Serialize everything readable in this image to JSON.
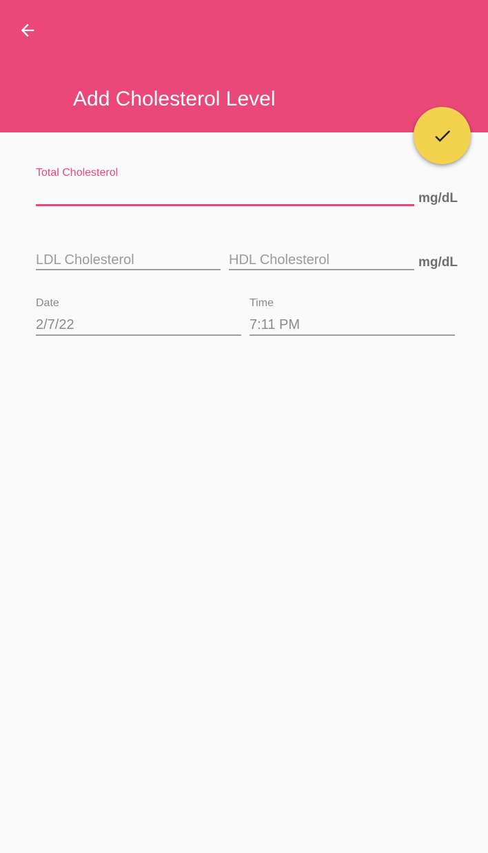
{
  "header": {
    "back_icon": "arrow-left-icon",
    "title": "Add Cholesterol Level",
    "background_color": "#ea4879"
  },
  "fab": {
    "icon": "check-icon",
    "color": "#f3d34e"
  },
  "form": {
    "total": {
      "label": "Total Cholesterol",
      "value": "",
      "unit": "mg/dL"
    },
    "ldl": {
      "placeholder": "LDL Cholesterol"
    },
    "hdl": {
      "placeholder": "HDL Cholesterol"
    },
    "ldl_hdl_unit": "mg/dL",
    "date": {
      "label": "Date",
      "value": "2/7/22"
    },
    "time": {
      "label": "Time",
      "value": "7:11 PM"
    }
  }
}
